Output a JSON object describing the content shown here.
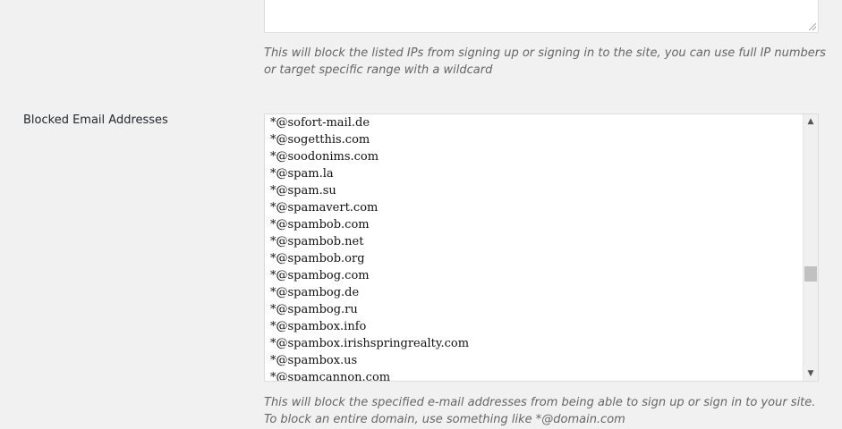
{
  "ip_section": {
    "description": "This will block the listed IPs from signing up or signing in to the site, you can use full IP numbers or target specific range with a wildcard"
  },
  "email_section": {
    "label": "Blocked Email Addresses",
    "entries": [
      "*@sofort-mail.de",
      "*@sogetthis.com",
      "*@soodonims.com",
      "*@spam.la",
      "*@spam.su",
      "*@spamavert.com",
      "*@spambob.com",
      "*@spambob.net",
      "*@spambob.org",
      "*@spambog.com",
      "*@spambog.de",
      "*@spambog.ru",
      "*@spambox.info",
      "*@spambox.irishspringrealty.com",
      "*@spambox.us",
      "*@spamcannon.com"
    ],
    "description": "This will block the specified e-mail addresses from being able to sign up or sign in to your site. To block an entire domain, use something like *@domain.com",
    "scroll_position": 0.62
  },
  "icons": {
    "scroll_up": "scroll-up-arrow-icon",
    "scroll_down": "scroll-down-arrow-icon",
    "resize": "resize-grip-icon"
  }
}
